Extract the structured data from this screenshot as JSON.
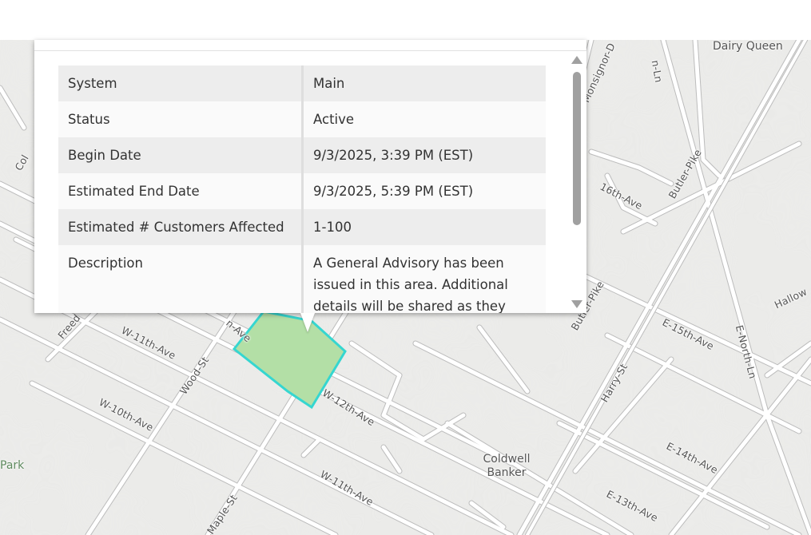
{
  "popup": {
    "rows": [
      {
        "key": "System",
        "value": "Main"
      },
      {
        "key": "Status",
        "value": "Active"
      },
      {
        "key": "Begin Date",
        "value": "9/3/2025, 3:39 PM (EST)"
      },
      {
        "key": "Estimated End Date",
        "value": "9/3/2025, 5:39 PM (EST)"
      },
      {
        "key": "Estimated # Customers Affected",
        "value": "1-100"
      },
      {
        "key": "Description",
        "value": "A General Advisory has been issued in this area. Additional details will be shared as they"
      }
    ]
  },
  "map": {
    "streets": {
      "w11_upper": "W-11th-Ave",
      "w11_lower": "W-11th-Ave",
      "w10": "W-10th-Ave",
      "w12": "W-12th-Ave",
      "wood": "Wood-St",
      "maple": "Maple-St",
      "freedom": "Freed",
      "col": "Col",
      "n_ave": "n-Ave",
      "monsignor": "Monsignor-D",
      "ln_top": "n-Ln",
      "sixteenth": "16th-Ave",
      "butler_pike_1": "Butler-Pike",
      "butler_pike_2": "Butler-Pike",
      "e15": "E-15th-Ave",
      "e14": "E-14th-Ave",
      "e13": "E-13th-Ave",
      "harry": "Harry-St",
      "e_north_ln": "E-North-Ln",
      "hallow": "Hallow"
    },
    "pois": {
      "dairy_queen": "Dairy Queen",
      "coldwell_banker": "Coldwell Banker",
      "park": "Park"
    },
    "colors": {
      "outage_fill": "#b3dfa6",
      "outage_outline": "#35d6d0",
      "road": "#ffffff",
      "road_edge": "#bdbdbd",
      "basemap": "#e9e9e7"
    }
  }
}
